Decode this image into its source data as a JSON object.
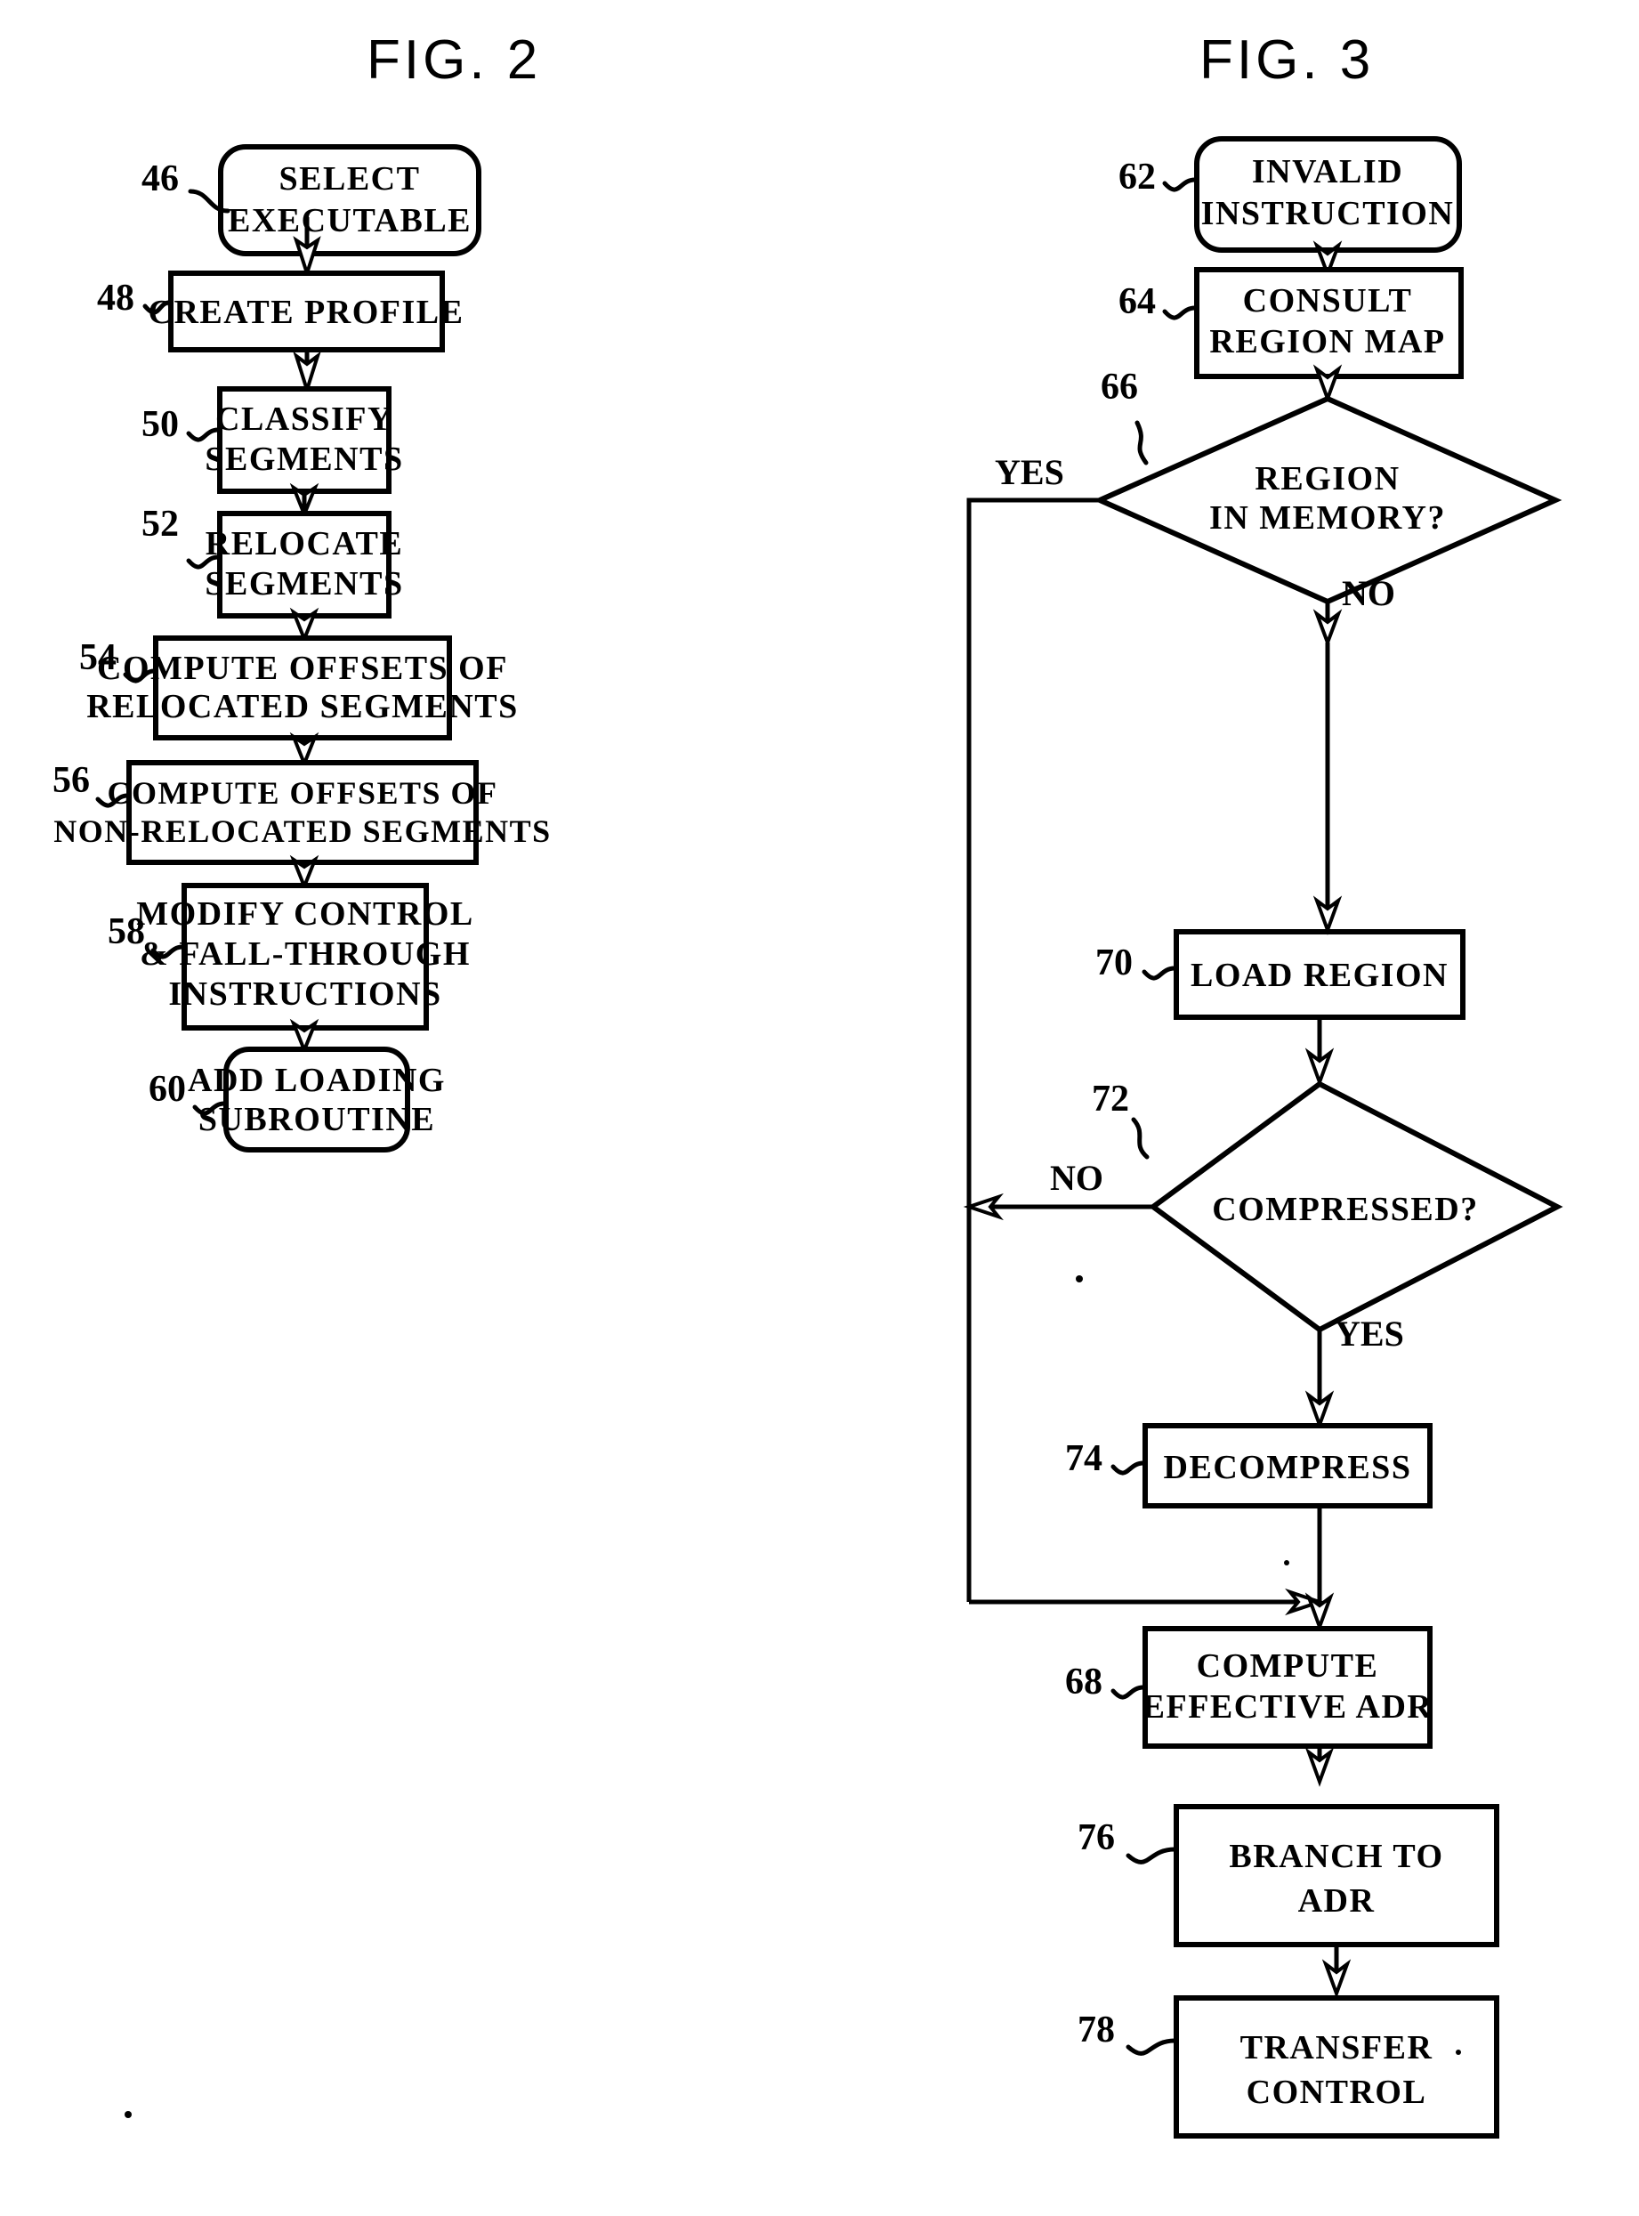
{
  "figures": [
    {
      "title": "FIG.  2",
      "nodes": [
        {
          "ref": "46",
          "lines": [
            "SELECT",
            "EXECUTABLE"
          ],
          "shape": "rounded-rect"
        },
        {
          "ref": "48",
          "lines": [
            "CREATE  PROFILE"
          ],
          "shape": "rect"
        },
        {
          "ref": "50",
          "lines": [
            "CLASSIFY",
            "SEGMENTS"
          ],
          "shape": "rect"
        },
        {
          "ref": "52",
          "lines": [
            "RELOCATE",
            "SEGMENTS"
          ],
          "shape": "rect"
        },
        {
          "ref": "54",
          "lines": [
            "COMPUTE  OFFSETS  OF",
            "RELOCATED  SEGMENTS"
          ],
          "shape": "rect"
        },
        {
          "ref": "56",
          "lines": [
            "COMPUTE  OFFSETS  OF",
            "NON-RELOCATED  SEGMENTS"
          ],
          "shape": "rect"
        },
        {
          "ref": "58",
          "lines": [
            "MODIFY  CONTROL",
            "& FALL-THROUGH",
            "INSTRUCTIONS"
          ],
          "shape": "rect"
        },
        {
          "ref": "60",
          "lines": [
            "ADD  LOADING",
            "SUBROUTINE"
          ],
          "shape": "rounded-rect"
        }
      ],
      "edge_labels": []
    },
    {
      "title": "FIG.  3",
      "nodes": [
        {
          "ref": "62",
          "lines": [
            "INVALID",
            "INSTRUCTION"
          ],
          "shape": "rounded-rect"
        },
        {
          "ref": "64",
          "lines": [
            "CONSULT",
            "REGION MAP"
          ],
          "shape": "rect"
        },
        {
          "ref": "66",
          "lines": [
            "REGION",
            "IN  MEMORY?"
          ],
          "shape": "diamond"
        },
        {
          "ref": "70",
          "lines": [
            "LOAD  REGION"
          ],
          "shape": "rect"
        },
        {
          "ref": "72",
          "lines": [
            "COMPRESSED?"
          ],
          "shape": "diamond"
        },
        {
          "ref": "74",
          "lines": [
            "DECOMPRESS"
          ],
          "shape": "rect"
        },
        {
          "ref": "68",
          "lines": [
            "COMPUTE",
            "EFFECTIVE  ADR"
          ],
          "shape": "rect"
        },
        {
          "ref": "76",
          "lines": [
            "BRANCH  TO",
            "ADR"
          ],
          "shape": "rect"
        },
        {
          "ref": "78",
          "lines": [
            "TRANSFER",
            "CONTROL"
          ],
          "shape": "rect"
        }
      ],
      "edge_labels": [
        {
          "id": "yes-66",
          "text": "YES"
        },
        {
          "id": "no-66",
          "text": "NO"
        },
        {
          "id": "no-72",
          "text": "NO"
        },
        {
          "id": "yes-72",
          "text": "YES"
        }
      ]
    }
  ],
  "colors": {
    "ink": "#000000",
    "paper": "#ffffff"
  }
}
